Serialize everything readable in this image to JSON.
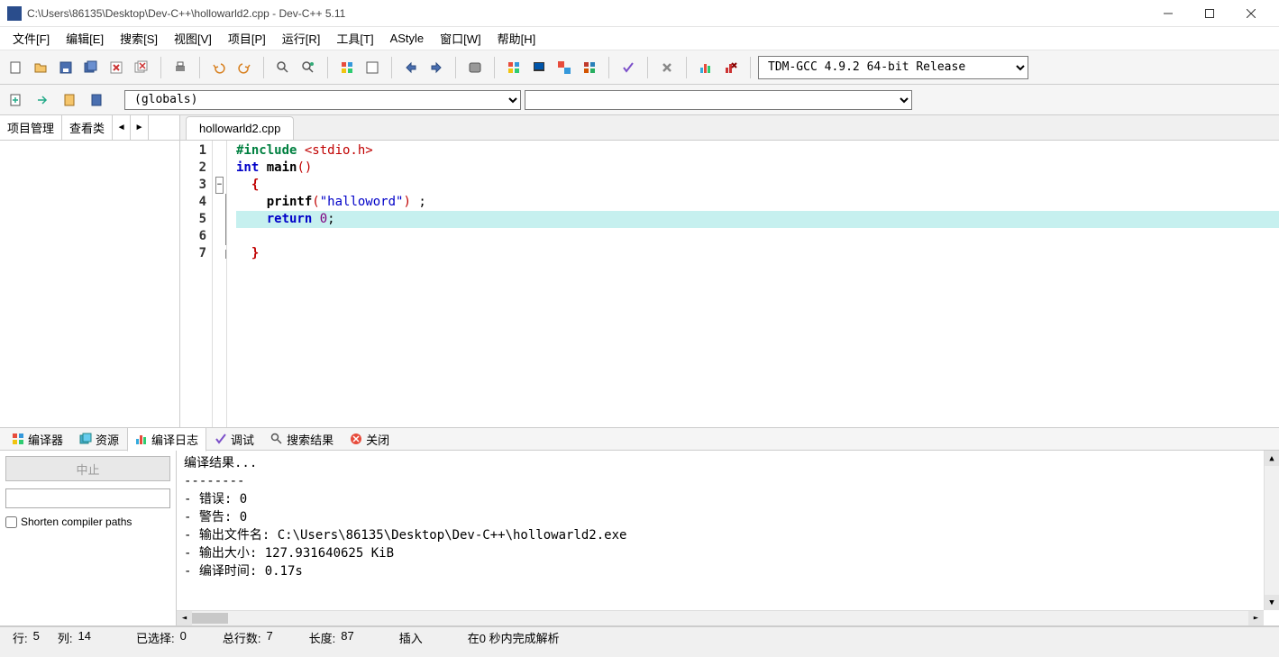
{
  "title": "C:\\Users\\86135\\Desktop\\Dev-C++\\hollowarld2.cpp - Dev-C++ 5.11",
  "menu": [
    "文件[F]",
    "编辑[E]",
    "搜索[S]",
    "视图[V]",
    "项目[P]",
    "运行[R]",
    "工具[T]",
    "AStyle",
    "窗口[W]",
    "帮助[H]"
  ],
  "compiler_selector": "TDM-GCC 4.9.2 64-bit Release",
  "globals_selector": "(globals)",
  "left_tabs": {
    "project": "项目管理",
    "classes": "查看类"
  },
  "file_tab": "hollowarld2.cpp",
  "code": {
    "line_numbers": [
      "1",
      "2",
      "3",
      "4",
      "5",
      "6",
      "7"
    ],
    "l1_a": "#include ",
    "l1_b": "<stdio.h>",
    "l2_a": "int",
    "l2_b": " main",
    "l2_c": "()",
    "l3": "  {",
    "l4_a": "    printf",
    "l4_b": "(",
    "l4_c": "\"halloword\"",
    "l4_d": ")",
    "l4_e": " ;",
    "l5_a": "    return",
    "l5_b": " ",
    "l5_c": "0",
    "l5_d": ";",
    "l6": "",
    "l7": "  }"
  },
  "bottom_tabs": {
    "compiler": "编译器",
    "resources": "资源",
    "log": "编译日志",
    "debug": "调试",
    "search": "搜索结果",
    "close": "关闭"
  },
  "abort": "中止",
  "shorten_label": "Shorten compiler paths",
  "log": "编译结果...\n--------\n- 错误: 0\n- 警告: 0\n- 输出文件名: C:\\Users\\86135\\Desktop\\Dev-C++\\hollowarld2.exe\n- 输出大小: 127.931640625 KiB\n- 编译时间: 0.17s",
  "status": {
    "line_lbl": "行:",
    "line_val": "5",
    "col_lbl": "列:",
    "col_val": "14",
    "sel_lbl": "已选择:",
    "sel_val": "0",
    "total_lbl": "总行数:",
    "total_val": "7",
    "len_lbl": "长度:",
    "len_val": "87",
    "mode": "插入",
    "parse": "在0 秒内完成解析"
  }
}
